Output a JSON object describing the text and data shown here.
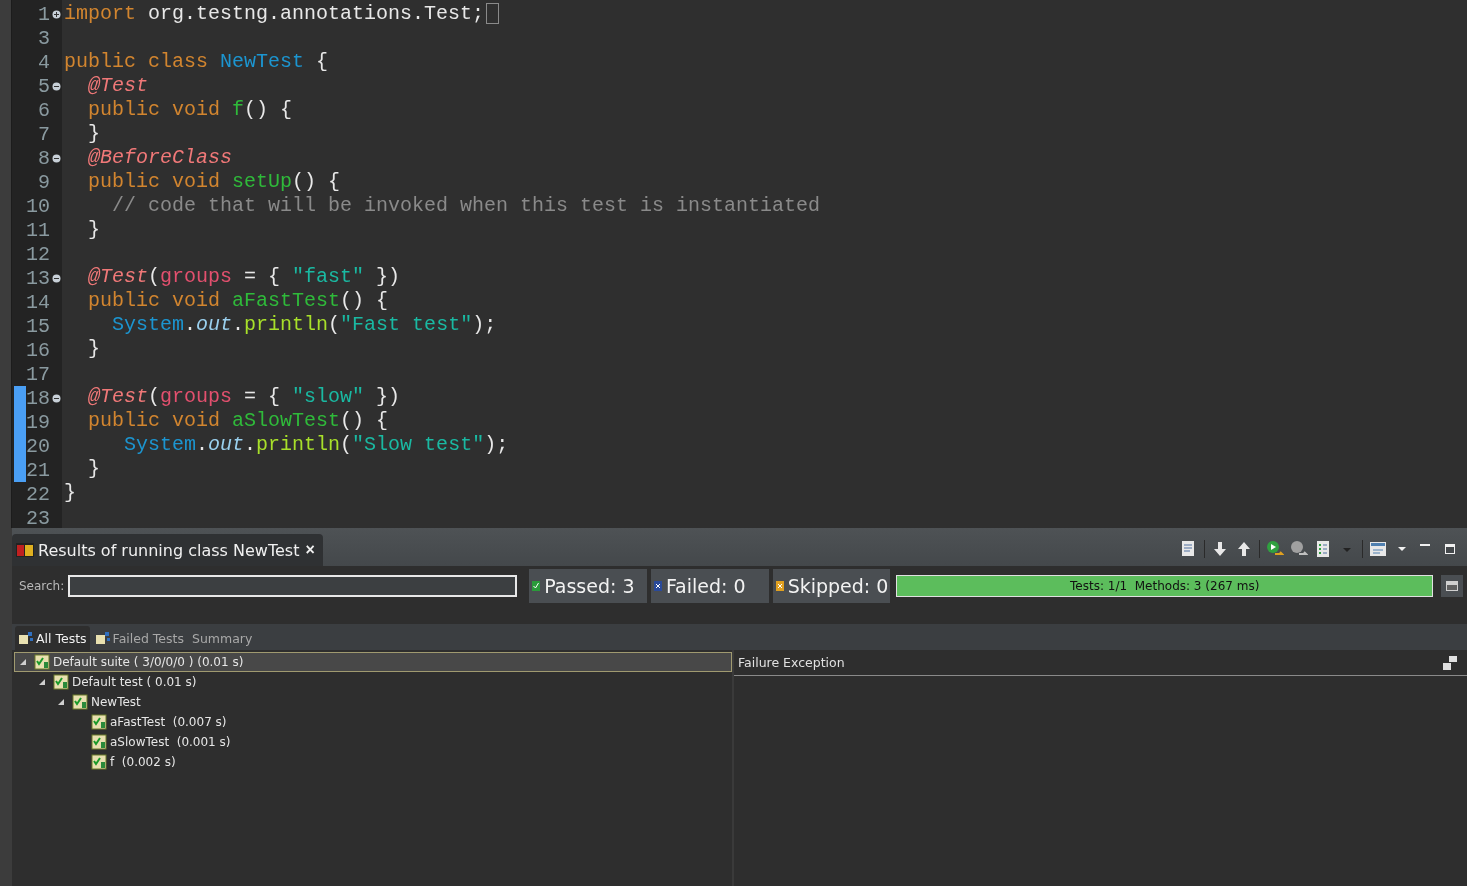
{
  "editor": {
    "lines": [
      {
        "number": "1",
        "kind": "fold-closed",
        "changed": false,
        "folded_ellipsis": true,
        "tokens": [
          {
            "text": "import ",
            "kind": "keyword"
          },
          {
            "text": "org.testng.annotations.Test;",
            "kind": "plain"
          }
        ]
      },
      {
        "number": "3",
        "kind": "plain",
        "changed": false
      },
      {
        "number": "4",
        "kind": "plain",
        "changed": false,
        "tokens": [
          {
            "text": "public class ",
            "kind": "keyword"
          },
          {
            "text": "NewTest",
            "kind": "type"
          },
          {
            "text": " {",
            "kind": "plain"
          }
        ]
      },
      {
        "number": "5",
        "kind": "fold-open",
        "changed": false,
        "tokens": [
          {
            "text": "  @Test",
            "kind": "annotation"
          }
        ]
      },
      {
        "number": "6",
        "kind": "plain",
        "changed": false,
        "tokens": [
          {
            "text": "  public void ",
            "kind": "keyword"
          },
          {
            "text": "f",
            "kind": "method"
          },
          {
            "text": "() {",
            "kind": "plain"
          }
        ]
      },
      {
        "number": "7",
        "kind": "plain",
        "changed": false,
        "tokens": [
          {
            "text": "  }",
            "kind": "plain"
          }
        ]
      },
      {
        "number": "8",
        "kind": "fold-open",
        "changed": false,
        "tokens": [
          {
            "text": "  @BeforeClass",
            "kind": "annotation"
          }
        ]
      },
      {
        "number": "9",
        "kind": "plain",
        "changed": false,
        "tokens": [
          {
            "text": "  public void ",
            "kind": "keyword"
          },
          {
            "text": "setUp",
            "kind": "method"
          },
          {
            "text": "() {",
            "kind": "plain"
          }
        ]
      },
      {
        "number": "10",
        "kind": "plain",
        "changed": false,
        "tokens": [
          {
            "text": "    // code that will be invoked when this test is instantiated",
            "kind": "comment"
          }
        ]
      },
      {
        "number": "11",
        "kind": "plain",
        "changed": false,
        "tokens": [
          {
            "text": "  }",
            "kind": "plain"
          }
        ]
      },
      {
        "number": "12",
        "kind": "plain",
        "changed": false
      },
      {
        "number": "13",
        "kind": "fold-open",
        "changed": false,
        "tokens": [
          {
            "text": "  @Test",
            "kind": "annotation"
          },
          {
            "text": "(",
            "kind": "plain"
          },
          {
            "text": "groups",
            "kind": "attr"
          },
          {
            "text": " = { ",
            "kind": "plain"
          },
          {
            "text": "\"fast\"",
            "kind": "string"
          },
          {
            "text": " })",
            "kind": "plain"
          }
        ]
      },
      {
        "number": "14",
        "kind": "plain",
        "changed": false,
        "tokens": [
          {
            "text": "  public void ",
            "kind": "keyword"
          },
          {
            "text": "aFastTest",
            "kind": "method"
          },
          {
            "text": "() {",
            "kind": "plain"
          }
        ]
      },
      {
        "number": "15",
        "kind": "plain",
        "changed": false,
        "tokens": [
          {
            "text": "    System",
            "kind": "type"
          },
          {
            "text": ".",
            "kind": "plain"
          },
          {
            "text": "out",
            "kind": "field"
          },
          {
            "text": ".",
            "kind": "plain"
          },
          {
            "text": "println",
            "kind": "call"
          },
          {
            "text": "(",
            "kind": "plain"
          },
          {
            "text": "\"Fast test\"",
            "kind": "string"
          },
          {
            "text": ");",
            "kind": "plain"
          }
        ]
      },
      {
        "number": "16",
        "kind": "plain",
        "changed": false,
        "tokens": [
          {
            "text": "  }",
            "kind": "plain"
          }
        ]
      },
      {
        "number": "17",
        "kind": "plain",
        "changed": false
      },
      {
        "number": "18",
        "kind": "fold-open",
        "changed": true,
        "tokens": [
          {
            "text": "  @Test",
            "kind": "annotation"
          },
          {
            "text": "(",
            "kind": "plain"
          },
          {
            "text": "groups",
            "kind": "attr"
          },
          {
            "text": " = { ",
            "kind": "plain"
          },
          {
            "text": "\"slow\"",
            "kind": "string"
          },
          {
            "text": " })",
            "kind": "plain"
          }
        ]
      },
      {
        "number": "19",
        "kind": "plain",
        "changed": true,
        "tokens": [
          {
            "text": "  public void ",
            "kind": "keyword"
          },
          {
            "text": "aSlowTest",
            "kind": "method"
          },
          {
            "text": "() {",
            "kind": "plain"
          }
        ]
      },
      {
        "number": "20",
        "kind": "plain",
        "changed": true,
        "tokens": [
          {
            "text": "     System",
            "kind": "type"
          },
          {
            "text": ".",
            "kind": "plain"
          },
          {
            "text": "out",
            "kind": "field"
          },
          {
            "text": ".",
            "kind": "plain"
          },
          {
            "text": "println",
            "kind": "call"
          },
          {
            "text": "(",
            "kind": "plain"
          },
          {
            "text": "\"Slow test\"",
            "kind": "string"
          },
          {
            "text": ");",
            "kind": "plain"
          }
        ]
      },
      {
        "number": "21",
        "kind": "plain",
        "changed": true,
        "tokens": [
          {
            "text": "  }",
            "kind": "plain"
          }
        ]
      },
      {
        "number": "22",
        "kind": "plain",
        "changed": false,
        "tokens": [
          {
            "text": "}",
            "kind": "plain"
          }
        ]
      },
      {
        "number": "23",
        "kind": "plain",
        "changed": false
      }
    ]
  },
  "results_view": {
    "tab": {
      "title": "Results of running class NewTest",
      "close": "×"
    },
    "search": {
      "label": "Search:"
    },
    "counters": [
      {
        "kind": "passed",
        "label": "Passed: 3"
      },
      {
        "kind": "failed",
        "label": "Failed: 0"
      },
      {
        "kind": "skipped",
        "label": "Skipped: 0"
      }
    ],
    "progress": {
      "level": 1,
      "text": "Tests: 1/1  Methods: 3 (267 ms)"
    },
    "subtabs": [
      {
        "label": "All Tests",
        "selected": true
      },
      {
        "label": "Failed Tests",
        "selected": false
      },
      {
        "label": "Summary",
        "selected": false
      }
    ],
    "tree": [
      {
        "label": "Default suite ( 3/0/0/0 ) (0.01 s)",
        "expanded": true,
        "selected": true,
        "children": [
          {
            "label": "Default test ( 0.01 s)",
            "expanded": true,
            "selected": false,
            "children": [
              {
                "label": "NewTest",
                "expanded": true,
                "selected": false,
                "children": [
                  {
                    "label": "aFastTest  (0.007 s)",
                    "selected": false
                  },
                  {
                    "label": "aSlowTest  (0.001 s)",
                    "selected": false
                  },
                  {
                    "label": "f  (0.002 s)",
                    "selected": false
                  }
                ]
              }
            ]
          }
        ]
      }
    ],
    "failure_panel": {
      "title": "Failure Exception"
    }
  }
}
